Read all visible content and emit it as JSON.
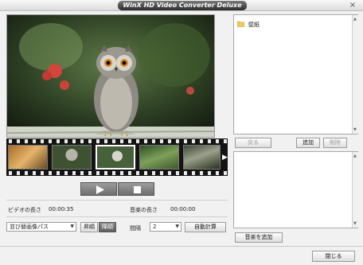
{
  "window": {
    "title": "WinX HD Video Converter Deluxe",
    "close_glyph": "×"
  },
  "preview": {
    "play_icon": "play-icon",
    "stop_icon": "stop-icon"
  },
  "filmstrip": {
    "arrow_glyph": "▶",
    "frame_count": 5
  },
  "info": {
    "video_length_label": "ビデオの長さ",
    "video_length_value": "00:00:35",
    "music_length_label": "音楽の長さ",
    "music_length_value": "00:00:00"
  },
  "controls": {
    "sort_select": "並び替画像パス",
    "order_asc": "昇順",
    "order_desc": "降順",
    "interval_label": "間隔",
    "interval_value": "2",
    "auto_set": "自動計算"
  },
  "folders": {
    "items": [
      {
        "name": "壁紙",
        "icon": "folder-icon"
      }
    ]
  },
  "folder_buttons": {
    "back": "戻る",
    "add": "追加",
    "delete": "削除"
  },
  "music": {
    "add_button": "音楽を追加"
  },
  "footer": {
    "close_button": "閉じる"
  }
}
